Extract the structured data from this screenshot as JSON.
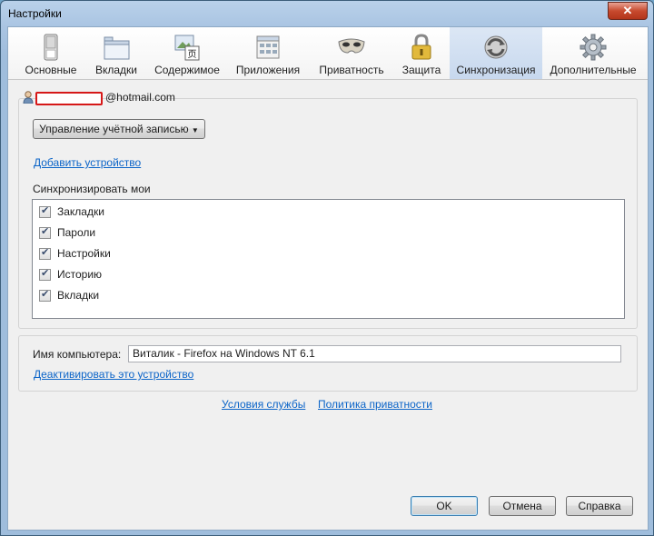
{
  "window": {
    "title": "Настройки",
    "close_glyph": "✕"
  },
  "toolbar": {
    "items": [
      {
        "label": "Основные",
        "icon": "general-switch-icon"
      },
      {
        "label": "Вкладки",
        "icon": "tabs-window-icon"
      },
      {
        "label": "Содержимое",
        "icon": "content-icon"
      },
      {
        "label": "Приложения",
        "icon": "applications-icon"
      },
      {
        "label": "Приватность",
        "icon": "privacy-mask-icon"
      },
      {
        "label": "Защита",
        "icon": "security-lock-icon"
      },
      {
        "label": "Синхронизация",
        "icon": "sync-icon",
        "selected": true
      },
      {
        "label": "Дополнительные",
        "icon": "advanced-gear-icon"
      }
    ],
    "selected_color": "#c7d8ee"
  },
  "account": {
    "email_suffix": "@hotmail.com",
    "redaction_color": "#d61818",
    "manage_button": "Управление учётной записью",
    "add_device_link": "Добавить устройство"
  },
  "sync": {
    "heading": "Синхронизировать мои",
    "items": [
      {
        "label": "Закладки",
        "checked": true
      },
      {
        "label": "Пароли",
        "checked": true
      },
      {
        "label": "Настройки",
        "checked": true
      },
      {
        "label": "Историю",
        "checked": true
      },
      {
        "label": "Вкладки",
        "checked": true
      }
    ]
  },
  "device": {
    "name_label": "Имя компьютера:",
    "name_value": "Виталик - Firefox на Windows NT 6.1",
    "deactivate_link": "Деактивировать это устройство"
  },
  "links": {
    "terms": "Условия службы",
    "privacy": "Политика приватности"
  },
  "buttons": {
    "ok": "OK",
    "cancel": "Отмена",
    "help": "Справка"
  },
  "colors": {
    "link": "#0b64c8",
    "titlebar": "#b9d1ea"
  }
}
